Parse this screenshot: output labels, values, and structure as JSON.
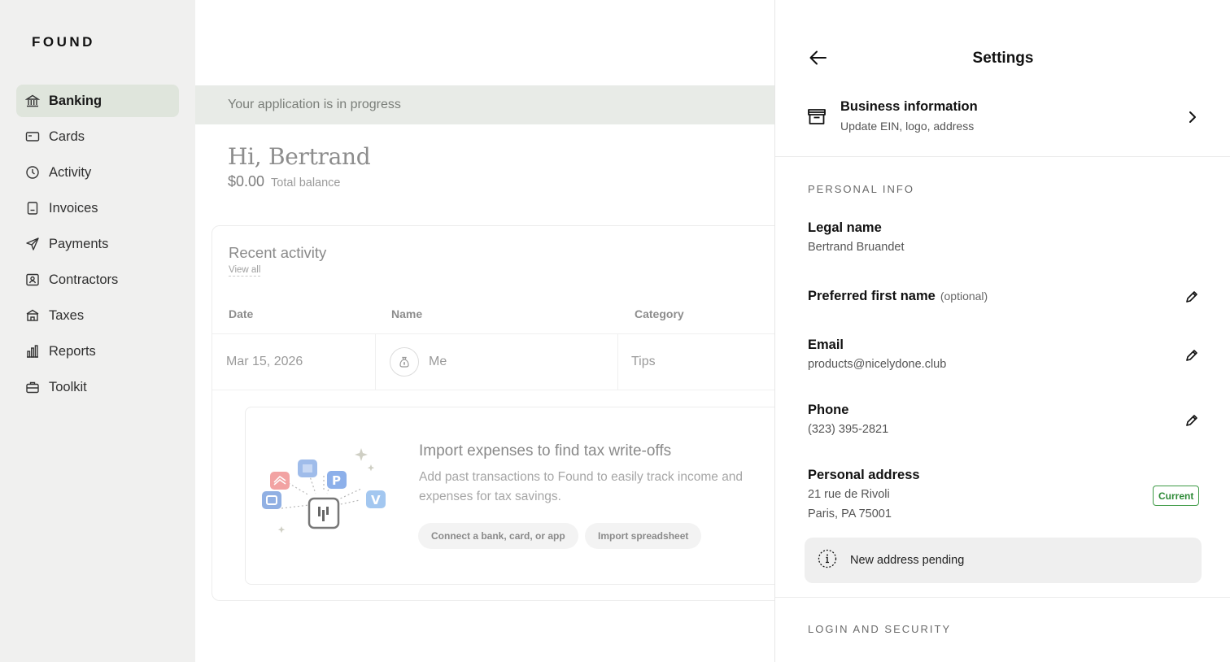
{
  "app": {
    "logo": "FOUND"
  },
  "sidebar": {
    "items": [
      {
        "label": "Banking",
        "icon": "bank-icon",
        "active": true
      },
      {
        "label": "Cards",
        "icon": "card-icon"
      },
      {
        "label": "Activity",
        "icon": "clock-icon"
      },
      {
        "label": "Invoices",
        "icon": "invoice-icon"
      },
      {
        "label": "Payments",
        "icon": "send-icon"
      },
      {
        "label": "Contractors",
        "icon": "contractor-icon"
      },
      {
        "label": "Taxes",
        "icon": "taxes-icon"
      },
      {
        "label": "Reports",
        "icon": "bar-chart-icon"
      },
      {
        "label": "Toolkit",
        "icon": "briefcase-icon"
      }
    ]
  },
  "main": {
    "banner": "Your application is in progress",
    "greeting": "Hi, Bertrand",
    "balance_amount": "$0.00",
    "balance_label": "Total balance",
    "recent": {
      "title": "Recent activity",
      "view_all": "View all",
      "columns": [
        "Date",
        "Name",
        "Category"
      ],
      "rows": [
        {
          "date": "Mar 15, 2026",
          "name": "Me",
          "category": "Tips"
        }
      ]
    },
    "import": {
      "title": "Import expenses to find tax write-offs",
      "description": "Add past transactions to Found to easily track income and expenses for tax savings.",
      "connect_label": "Connect a bank, card, or app",
      "spreadsheet_label": "Import spreadsheet"
    }
  },
  "settings": {
    "title": "Settings",
    "business": {
      "title": "Business information",
      "subtitle": "Update EIN, logo, address"
    },
    "personal_section": "PERSONAL INFO",
    "legal_name": {
      "label": "Legal name",
      "value": "Bertrand Bruandet"
    },
    "preferred_name": {
      "label": "Preferred first name",
      "optional": "(optional)"
    },
    "email": {
      "label": "Email",
      "value": "products@nicelydone.club"
    },
    "phone": {
      "label": "Phone",
      "value": "(323) 395-2821"
    },
    "address": {
      "label": "Personal address",
      "line1": "21 rue de Rivoli",
      "line2": "Paris, PA 75001",
      "badge": "Current"
    },
    "pending": "New address pending",
    "security_section": "LOGIN AND SECURITY"
  },
  "colors": {
    "active_nav_bg": "#dfe5dc",
    "badge_green": "#2e8a37",
    "sidebar_bg": "#f0f0ef"
  }
}
